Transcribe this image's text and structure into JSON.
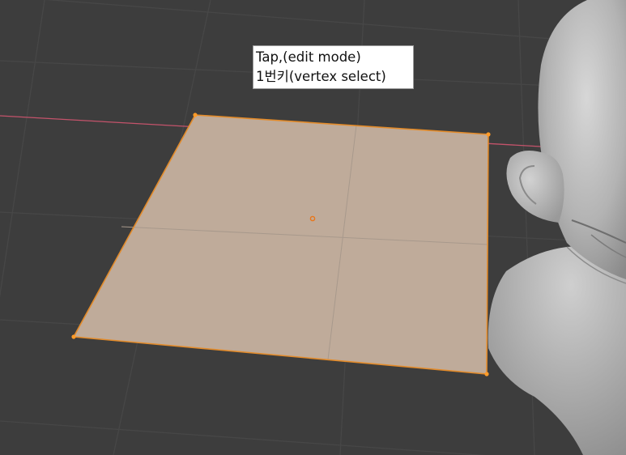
{
  "caption": {
    "line1": "Tap,(edit mode)",
    "line2": "1번키(vertex select)"
  },
  "colors": {
    "background": "#3d3d3d",
    "grid": "#474747",
    "x_axis": "#c4536b",
    "face_fill": "#bfab9a",
    "edge_selected": "#e38b2a",
    "vertex_selected": "#ff9b29",
    "model": "#b8b8b8"
  },
  "icons": {
    "object_origin": "origin-dot-icon"
  }
}
